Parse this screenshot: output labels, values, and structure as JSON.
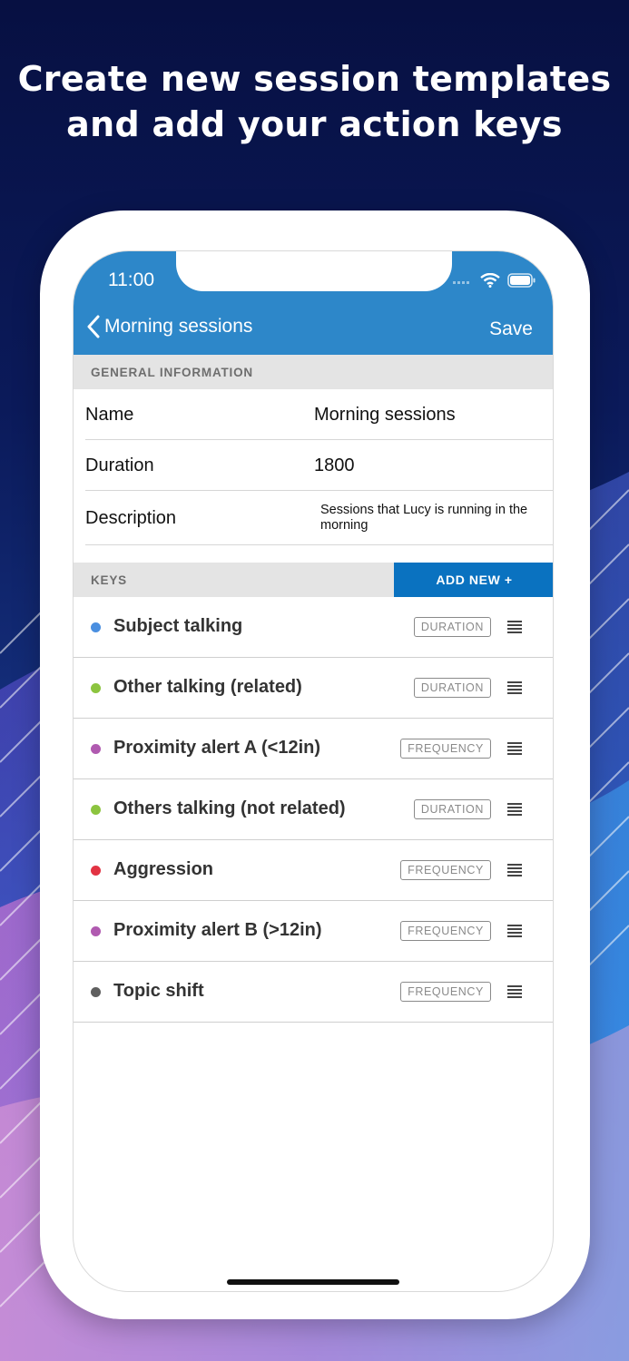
{
  "headline": {
    "line1": "Create new session templates",
    "line2": "and add your action keys"
  },
  "status_bar": {
    "time": "11:00",
    "icons": [
      "signal-icon",
      "wifi-icon",
      "battery-icon"
    ]
  },
  "nav": {
    "back_label": "Morning sessions",
    "save_label": "Save",
    "back_icon": "chevron-left-icon"
  },
  "general": {
    "header": "GENERAL INFORMATION",
    "fields": [
      {
        "label": "Name",
        "value": "Morning sessions"
      },
      {
        "label": "Duration",
        "value": "1800"
      },
      {
        "label": "Description",
        "value": "Sessions that Lucy is running in the morning"
      }
    ]
  },
  "keys": {
    "header": "KEYS",
    "add_new_label": "ADD NEW +",
    "items": [
      {
        "name": "Subject talking",
        "type": "DURATION",
        "color": "#4a8fe0"
      },
      {
        "name": "Other talking (related)",
        "type": "DURATION",
        "color": "#8cc43f"
      },
      {
        "name": "Proximity alert A (<12in)",
        "type": "FREQUENCY",
        "color": "#b05ab0"
      },
      {
        "name": "Others talking (not related)",
        "type": "DURATION",
        "color": "#8cc43f"
      },
      {
        "name": "Aggression",
        "type": "FREQUENCY",
        "color": "#e23343"
      },
      {
        "name": "Proximity alert B (>12in)",
        "type": "FREQUENCY",
        "color": "#b05ab0"
      },
      {
        "name": "Topic shift",
        "type": "FREQUENCY",
        "color": "#5f5f5f"
      }
    ]
  },
  "colors": {
    "nav_bar": "#2d87c9",
    "add_new": "#0a72c0",
    "section_header": "#e4e4e4"
  }
}
